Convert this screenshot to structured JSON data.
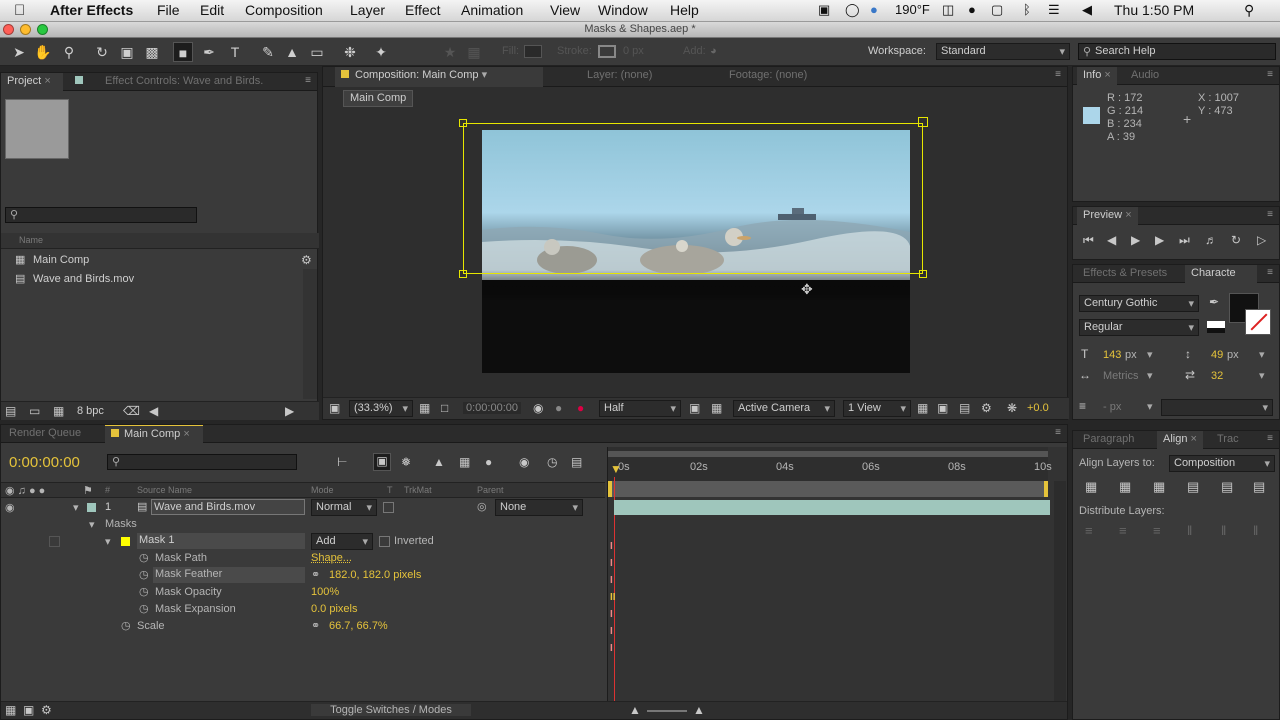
{
  "menubar": {
    "apple_glyph": "",
    "app": "After Effects",
    "items": [
      "File",
      "Edit",
      "Composition",
      "Layer",
      "Effect",
      "Animation",
      "View",
      "Window",
      "Help"
    ],
    "temperature": "190°F",
    "clock": "Thu 1:50 PM"
  },
  "window": {
    "title": "Masks & Shapes.aep *"
  },
  "toolbar": {
    "fill_label": "Fill:",
    "stroke_label": "Stroke:",
    "stroke_value": "0 px",
    "add_label": "Add:",
    "workspace_label": "Workspace:",
    "workspace_value": "Standard",
    "search_placeholder": "Search Help"
  },
  "project": {
    "tab_project": "Project",
    "tab_effect_controls": "Effect Controls: Wave and Birds.",
    "column_name": "Name",
    "items": [
      "Main Comp",
      "Wave and Birds.mov"
    ],
    "bpc": "8 bpc"
  },
  "composition": {
    "tab_comp": "Composition: Main Comp",
    "tab_layer": "Layer: (none)",
    "tab_footage": "Footage: (none)",
    "breadcrumb": "Main Comp",
    "zoom": "(33.3%)",
    "timecode": "0:00:00:00",
    "resolution": "Half",
    "camera": "Active Camera",
    "views": "1 View",
    "exposure": "+0.0"
  },
  "info": {
    "tab_info": "Info",
    "tab_audio": "Audio",
    "r": "R : 172",
    "g": "G : 214",
    "b": "B : 234",
    "a": "A : 39",
    "x": "X : 1007",
    "y": "Y : 473",
    "swatch_color": "#acd6ea"
  },
  "preview": {
    "tab": "Preview"
  },
  "character": {
    "tab_effects": "Effects & Presets",
    "tab_character": "Characte",
    "font": "Century Gothic",
    "style": "Regular",
    "size": "143",
    "size_unit": "px",
    "leading": "49",
    "leading_unit": "px",
    "kerning": "Metrics",
    "tracking": "32",
    "stroke_unit": "- px"
  },
  "align": {
    "tab_paragraph": "Paragraph",
    "tab_align": "Align",
    "tab_tracker": "Trac",
    "align_to_label": "Align Layers to:",
    "align_to_value": "Composition",
    "distribute_label": "Distribute Layers:"
  },
  "timeline": {
    "tab_render": "Render Queue",
    "tab_main": "Main Comp",
    "timecode": "0:00:00:00",
    "col_hash": "#",
    "col_source": "Source Name",
    "col_mode": "Mode",
    "col_t": "T",
    "col_trkmat": "TrkMat",
    "col_parent": "Parent",
    "layer_num": "1",
    "layer_name": "Wave and Birds.mov",
    "layer_mode": "Normal",
    "layer_parent": "None",
    "masks_group": "Masks",
    "mask_name": "Mask 1",
    "mask_mode": "Add",
    "inverted_label": "Inverted",
    "props": [
      {
        "name": "Mask Path",
        "value": "Shape..."
      },
      {
        "name": "Mask Feather",
        "value": "182.0, 182.0 pixels"
      },
      {
        "name": "Mask Opacity",
        "value": "100%"
      },
      {
        "name": "Mask Expansion",
        "value": "0.0 pixels"
      },
      {
        "name": "Scale",
        "value": "66.7, 66.7%"
      }
    ],
    "ruler": [
      "0s",
      "02s",
      "04s",
      "06s",
      "08s",
      "10s"
    ],
    "toggle_label": "Toggle Switches / Modes"
  },
  "colors": {
    "accent_yellow": "#e5c33b",
    "layer_bar": "#9fc6bc",
    "mask_yellow": "#ffff00"
  }
}
